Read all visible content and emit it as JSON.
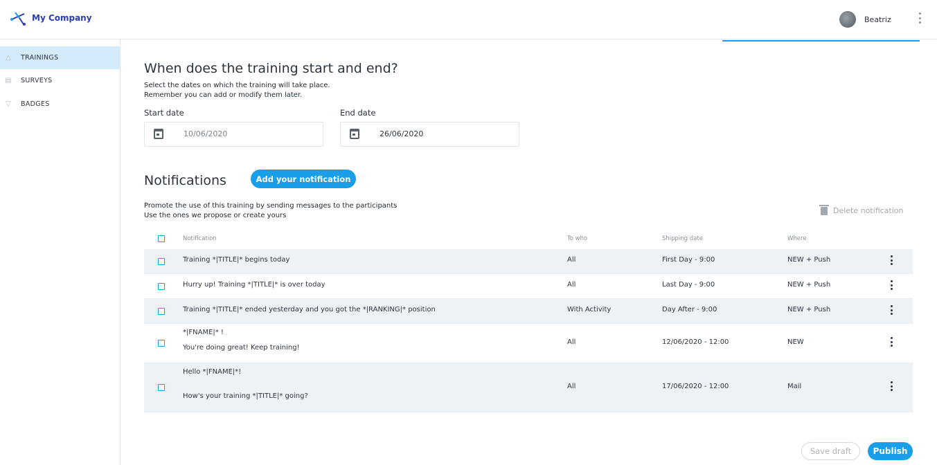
{
  "header": {
    "company": "My Company",
    "user_name": "Beatriz"
  },
  "sidebar": {
    "items": [
      {
        "label": "TRAININGS",
        "icon": "graduation-cap-icon",
        "active": true
      },
      {
        "label": "SURVEYS",
        "icon": "document-icon",
        "active": false
      },
      {
        "label": "BADGES",
        "icon": "badge-icon",
        "active": false
      }
    ]
  },
  "dates": {
    "title": "When does the training start and end?",
    "description_1": "Select the dates on which the training will take place.",
    "description_2": "Remember you can add or modify them later.",
    "start_label": "Start date",
    "start_value": "10/06/2020",
    "end_label": "End date",
    "end_value": "26/06/2020"
  },
  "notifications": {
    "title": "Notifications",
    "add_button": "Add your notification",
    "description_1": "Promote the use of this training by sending messages to the participants",
    "description_2": "Use the ones we propose or create yours",
    "delete_label": "Delete notification",
    "columns": {
      "notification": "Notification",
      "to_who": "To who",
      "shipping_date": "Shipping date",
      "where": "Where"
    },
    "rows": [
      {
        "line1": "Training *|TITLE|* begins today",
        "line2": "",
        "to": "All",
        "date": "First Day - 9:00",
        "where": "NEW + Push"
      },
      {
        "line1": "Hurry up! Training *|TITLE|* is over today",
        "line2": "",
        "to": "All",
        "date": "Last Day - 9:00",
        "where": "NEW + Push"
      },
      {
        "line1": "Training *|TITLE|* ended yesterday and you got the *|RANKING|* position",
        "line2": "",
        "to": "With Activity",
        "date": "Day After - 9:00",
        "where": "NEW + Push"
      },
      {
        "line1": "*|FNAME|* !",
        "line2": "You're doing great! Keep training!",
        "to": "All",
        "date": "12/06/2020 - 12:00",
        "where": "NEW"
      },
      {
        "line1": "Hello *|FNAME|*!",
        "line2": "How's your training *|TITLE|* going?",
        "to": "All",
        "date": "17/06/2020 - 12:00",
        "where": "Mail"
      }
    ]
  },
  "footer": {
    "save_draft": "Save draft",
    "publish": "Publish"
  },
  "colors": {
    "accent": "#1a9ee8",
    "brand": "#2b3db5",
    "sidebar_active": "#d4ebfb"
  }
}
